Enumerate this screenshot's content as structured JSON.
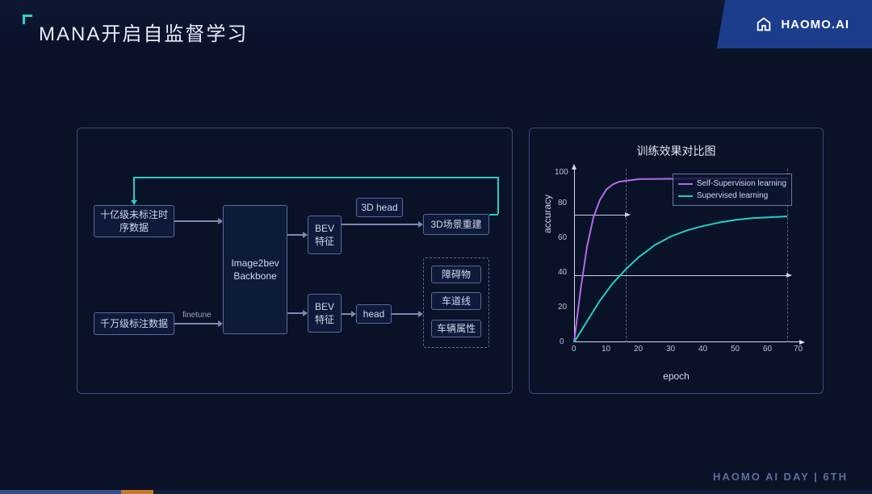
{
  "header": {
    "title": "MANA开启自监督学习",
    "brand": "HAOMO.AI"
  },
  "flow": {
    "unlabeled": "十亿级未标注时\n序数据",
    "labeled": "千万级标注数据",
    "backbone": "Image2bev\nBackbone",
    "bev1": "BEV\n特征",
    "bev2": "BEV\n特征",
    "head3d": "3D head",
    "head": "head",
    "scene": "3D场景重建",
    "obstacle": "障碍物",
    "lane": "车道线",
    "vehicle": "车辆属性",
    "finetune": "finetune"
  },
  "chart_data": {
    "type": "line",
    "title": "训练效果对比图",
    "xlabel": "epoch",
    "ylabel": "accuracy",
    "xlim": [
      0,
      70
    ],
    "ylim": [
      0,
      100
    ],
    "x_ticks": [
      0,
      10,
      20,
      30,
      40,
      50,
      60,
      70
    ],
    "y_ticks": [
      0,
      20,
      40,
      60,
      80,
      100
    ],
    "series": [
      {
        "name": "Self-Supervision learning",
        "color": "#b26bea",
        "x": [
          0,
          2,
          4,
          6,
          8,
          10,
          12,
          14,
          16,
          18,
          20,
          30,
          50,
          66
        ],
        "y": [
          0,
          30,
          55,
          72,
          82,
          88,
          91,
          92.5,
          93,
          93.5,
          94,
          94.2,
          94.4,
          94.5
        ]
      },
      {
        "name": "Supervised learning",
        "color": "#20d0c6",
        "x": [
          0,
          4,
          8,
          12,
          16,
          20,
          25,
          30,
          35,
          40,
          45,
          50,
          55,
          60,
          66
        ],
        "y": [
          0,
          12,
          24,
          34,
          42,
          49,
          56,
          61,
          64.5,
          67,
          69,
          70.5,
          71.5,
          72,
          72.5
        ]
      }
    ],
    "reference_lines": {
      "self_supervision_epoch": 16,
      "self_supervision_acc": 73,
      "supervised_epoch": 66,
      "supervised_acc": 38
    }
  },
  "footer": "HAOMO AI DAY | 6TH"
}
